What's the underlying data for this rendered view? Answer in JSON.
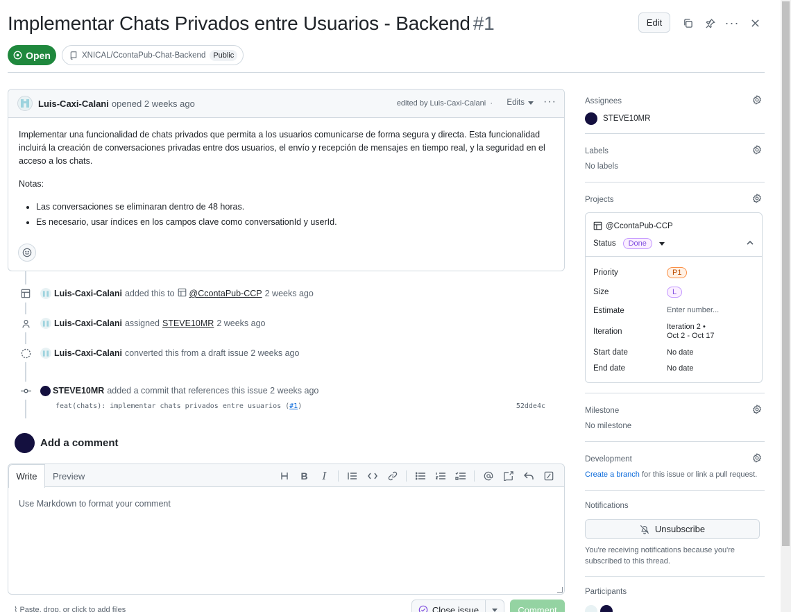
{
  "issue": {
    "title": "Implementar Chats Privados entre Usuarios - Backend",
    "number": "#1",
    "state": "Open",
    "repo": "XNICAL/CcontaPub-Chat-Backend",
    "visibility": "Public",
    "edit_label": "Edit"
  },
  "comment": {
    "author": "Luis-Caxi-Calani",
    "action": "opened 2 weeks ago",
    "edited_by": "edited by Luis-Caxi-Calani",
    "edits_label": "Edits",
    "body_p1": "Implementar una funcionalidad de chats privados que permita a los usuarios comunicarse de forma segura y directa. Esta funcionalidad incluirá la creación de conversaciones privadas entre dos usuarios, el envío y recepción de mensajes en tiempo real, y la seguridad en el acceso a los chats.",
    "notes_label": "Notas:",
    "bullets": [
      "Las conversaciones se eliminaran dentro de 48 horas.",
      "Es necesario, usar índices en los campos clave como conversationId y userId."
    ]
  },
  "timeline": [
    {
      "who": "Luis-Caxi-Calani",
      "pre": "added this to",
      "link": "@CcontaPub-CCP",
      "post": "2 weeks ago"
    },
    {
      "who": "Luis-Caxi-Calani",
      "pre": "assigned",
      "link": "STEVE10MR",
      "post": "2 weeks ago"
    },
    {
      "who": "Luis-Caxi-Calani",
      "pre": "converted this from a draft issue 2 weeks ago",
      "link": "",
      "post": ""
    },
    {
      "who": "STEVE10MR",
      "pre": "added a commit that references this issue 2 weeks ago",
      "link": "",
      "post": ""
    }
  ],
  "commit": {
    "message": "feat(chats): implementar chats privados entre usuarios (",
    "ref": "#1",
    "close_paren": ")",
    "sha": "52dde4c"
  },
  "composer": {
    "heading": "Add a comment",
    "tab_write": "Write",
    "tab_preview": "Preview",
    "placeholder": "Use Markdown to format your comment",
    "paste_hint": "Paste, drop, or click to add files",
    "close_issue": "Close issue",
    "comment_btn": "Comment"
  },
  "sidebar": {
    "assignees_title": "Assignees",
    "assignee": "STEVE10MR",
    "labels_title": "Labels",
    "labels_value": "No labels",
    "projects_title": "Projects",
    "project_name": "@CcontaPub-CCP",
    "status_label": "Status",
    "status_value": "Done",
    "fields": [
      {
        "label": "Priority",
        "value": "P1"
      },
      {
        "label": "Size",
        "value": "L"
      },
      {
        "label": "Estimate",
        "value": "Enter number..."
      },
      {
        "label": "Iteration",
        "value": "Iteration 2 •",
        "value2": "Oct 2 - Oct 17"
      },
      {
        "label": "Start date",
        "value": "No date"
      },
      {
        "label": "End date",
        "value": "No date"
      }
    ],
    "milestone_title": "Milestone",
    "milestone_value": "No milestone",
    "development_title": "Development",
    "dev_link": "Create a branch",
    "dev_text": " for this issue or link a pull request.",
    "notifications_title": "Notifications",
    "unsubscribe": "Unsubscribe",
    "notif_text": "You're receiving notifications because you're subscribed to this thread.",
    "participants_title": "Participants"
  },
  "colors": {
    "open_green": "#1f883d",
    "link_blue": "#0969da",
    "avatar_dark": "#14103f"
  }
}
